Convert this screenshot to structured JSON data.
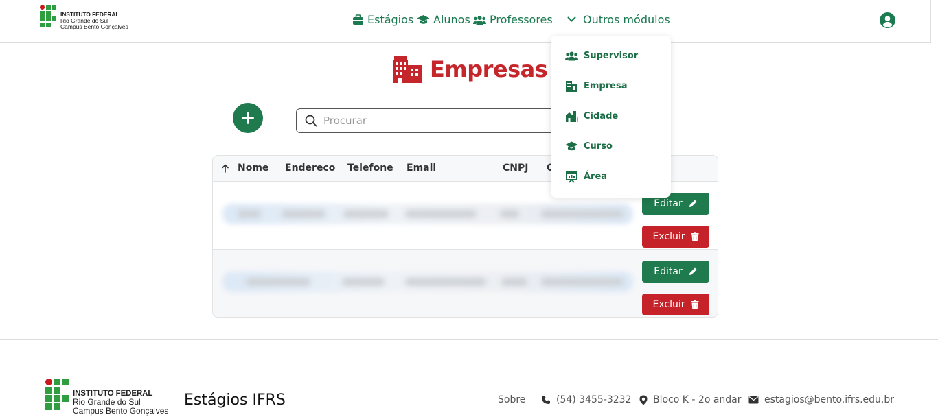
{
  "header": {
    "logo": {
      "line1": "INSTITUTO FEDERAL",
      "line2": "Rio Grande do Sul",
      "line3": "Campus Bento Gonçalves"
    },
    "nav": [
      {
        "label": "Estágios",
        "icon": "briefcase-icon"
      },
      {
        "label": "Alunos",
        "icon": "graduation-cap-icon"
      },
      {
        "label": "Professores",
        "icon": "users-icon"
      },
      {
        "label": "Outros módulos",
        "icon": "chevron-down-icon"
      }
    ],
    "avatar_icon": "user-circle-icon"
  },
  "dropdown": {
    "items": [
      {
        "label": "Supervisor",
        "icon": "users-icon"
      },
      {
        "label": "Empresa",
        "icon": "building-icon"
      },
      {
        "label": "Cidade",
        "icon": "city-icon"
      },
      {
        "label": "Curso",
        "icon": "graduation-cap-icon"
      },
      {
        "label": "Área",
        "icon": "presentation-chart-icon"
      }
    ]
  },
  "page": {
    "title": "Empresas",
    "title_icon": "building-icon",
    "add_icon": "plus-icon",
    "search": {
      "placeholder": "Procurar",
      "value": ""
    }
  },
  "table": {
    "sort_icon": "arrow-up-icon",
    "columns": [
      "Nome",
      "Endereco",
      "Telefone",
      "Email",
      "CNPJ",
      "C"
    ],
    "rows_count_visible": 2,
    "edit_label": "Editar",
    "delete_label": "Excluir"
  },
  "footer": {
    "logo": {
      "line1": "INSTITUTO FEDERAL",
      "line2": "Rio Grande do Sul",
      "line3": "Campus Bento Gonçalves"
    },
    "brand": "Estágios IFRS",
    "links": [
      {
        "label": "Sobre",
        "icon": ""
      },
      {
        "label": "(54) 3455-3232",
        "icon": "phone-icon"
      },
      {
        "label": "Bloco K - 2o andar",
        "icon": "map-pin-icon"
      },
      {
        "label": "estagios@bento.ifrs.edu.br",
        "icon": "envelope-icon"
      }
    ]
  },
  "colors": {
    "primary": "#1f7a4d",
    "danger": "#c5222a",
    "title": "#c5262c"
  }
}
